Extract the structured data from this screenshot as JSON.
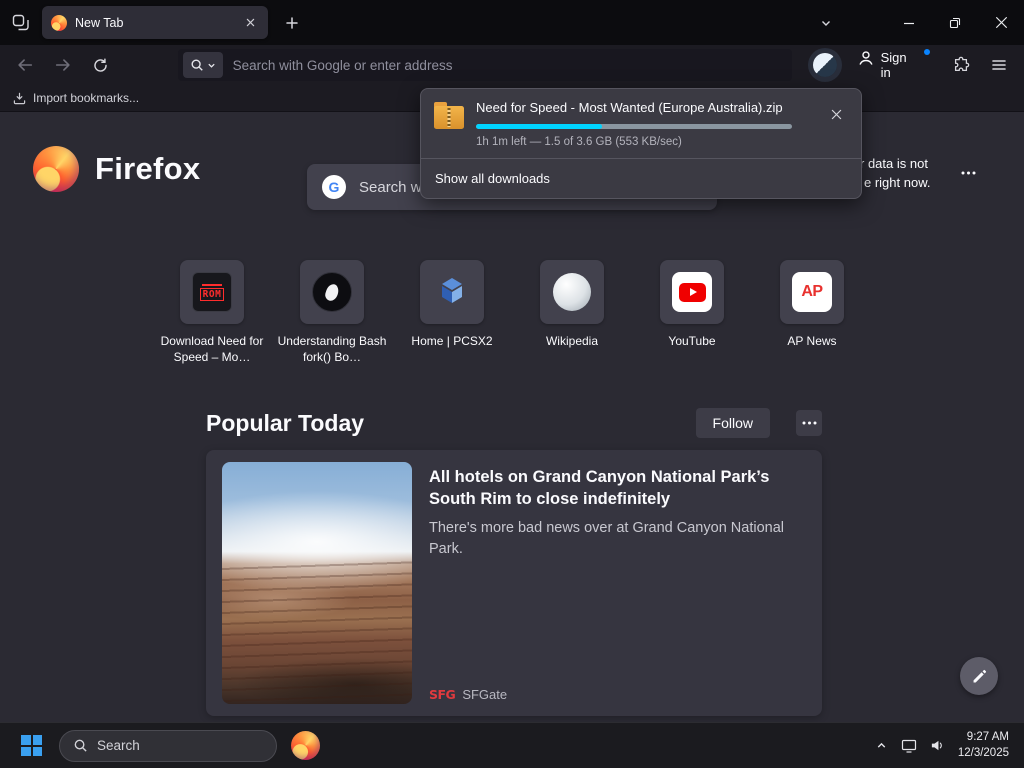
{
  "colors": {
    "progress_fill": "#00d4ff",
    "accent_blue": "#0a84ff",
    "firefox_orange": "#ff9640",
    "youtube_red": "#f00000",
    "ap_red": "#e8312e",
    "sfgate_red": "#e03a3e",
    "taskbar_windows_blue": "#3aa0f0",
    "page_background": "#2b2a33"
  },
  "browser": {
    "tab_title": "New Tab",
    "url_placeholder": "Search with Google or enter address",
    "sign_in_label": "Sign in",
    "import_bookmarks_label": "Import bookmarks..."
  },
  "downloads": {
    "filename": "Need for Speed - Most Wanted (Europe Australia).zip",
    "status": "1h 1m left — 1.5 of 3.6 GB (553 KB/sec)",
    "progress_percent": 40,
    "show_all_label": "Show all downloads"
  },
  "newtab": {
    "brand": "Firefox",
    "google_g": "G",
    "search_visible_text": "Search w",
    "widget_line1": "r data is not",
    "widget_line2": "e right now.",
    "shortcuts": [
      {
        "label": "Download Need for Speed – Mo…",
        "badge": "ROM"
      },
      {
        "label": "Understanding Bash fork() Bo…"
      },
      {
        "label": "Home | PCSX2"
      },
      {
        "label": "Wikipedia"
      },
      {
        "label": "YouTube"
      },
      {
        "label": "AP News",
        "badge": "AP"
      }
    ],
    "popular_heading": "Popular Today",
    "follow_label": "Follow",
    "card": {
      "title": "All hotels on Grand Canyon National Park’s South Rim to close indefinitely",
      "description": "There's more bad news over at Grand Canyon National Park.",
      "source_logo": "SFG",
      "source": "SFGate"
    }
  },
  "taskbar": {
    "search_placeholder": "Search",
    "time": "9:27 AM",
    "date": "12/3/2025"
  }
}
